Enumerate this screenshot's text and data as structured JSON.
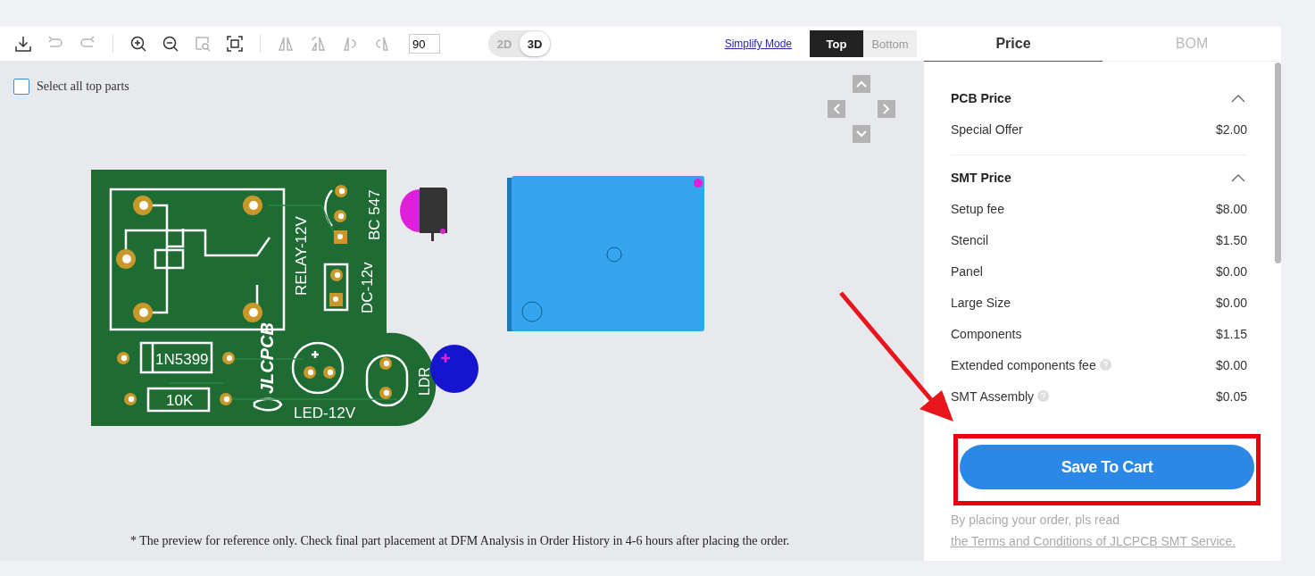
{
  "toolbar": {
    "groups": [
      [
        {
          "kind": "download",
          "disabled": false
        },
        {
          "kind": "undo",
          "disabled": true
        },
        {
          "kind": "redo",
          "disabled": true
        }
      ],
      [
        {
          "kind": "zoom-in",
          "disabled": false
        },
        {
          "kind": "zoom-out",
          "disabled": false
        },
        {
          "kind": "zoom-area",
          "disabled": true
        },
        {
          "kind": "fit",
          "disabled": false
        }
      ],
      [
        {
          "kind": "flip-h",
          "disabled": true
        },
        {
          "kind": "flip-v",
          "disabled": true
        },
        {
          "kind": "rotate-left",
          "disabled": true
        },
        {
          "kind": "rotate-right",
          "disabled": true
        }
      ]
    ],
    "rotation": "90",
    "view_modes": [
      {
        "label": "2D",
        "selected": false
      },
      {
        "label": "3D",
        "selected": true
      }
    ],
    "simplify_link": "Simplify Mode",
    "sides": [
      {
        "label": "Top",
        "selected": true
      },
      {
        "label": "Bottom",
        "selected": false
      }
    ]
  },
  "canvas": {
    "select_all": {
      "label": "Select all top parts",
      "checked": false
    },
    "silkscreen": {
      "relay": "RELAY-12V",
      "transistor": "BC 547",
      "power": "DC-12v",
      "diode": "1N5399",
      "resistor": "10K",
      "logo": "JLCPCB",
      "led": "LED-12V",
      "ldr": "LDR"
    },
    "note": "* The preview for reference only. Check final part placement at DFM Analysis in Order History in 4-6 hours after placing the order."
  },
  "panel": {
    "tabs": [
      {
        "label": "Price",
        "selected": true
      },
      {
        "label": "BOM",
        "selected": false
      }
    ],
    "sections": [
      {
        "title": "PCB Price",
        "expanded": true,
        "items": [
          {
            "label": "Special Offer",
            "value": "$2.00",
            "help": false
          }
        ]
      },
      {
        "title": "SMT Price",
        "expanded": true,
        "items": [
          {
            "label": "Setup fee",
            "value": "$8.00",
            "help": false
          },
          {
            "label": "Stencil",
            "value": "$1.50",
            "help": false
          },
          {
            "label": "Panel",
            "value": "$0.00",
            "help": false
          },
          {
            "label": "Large Size",
            "value": "$0.00",
            "help": false
          },
          {
            "label": "Components",
            "value": "$1.15",
            "help": false
          },
          {
            "label": "Extended components fee",
            "value": "$0.00",
            "help": true
          },
          {
            "label": "SMT Assembly",
            "value": "$0.05",
            "help": true
          }
        ]
      }
    ],
    "button": "Save To Cart",
    "terms": {
      "text": "By placing your order, pls read ",
      "link": "the Terms and Conditions of JLCPCB SMT Service."
    }
  }
}
